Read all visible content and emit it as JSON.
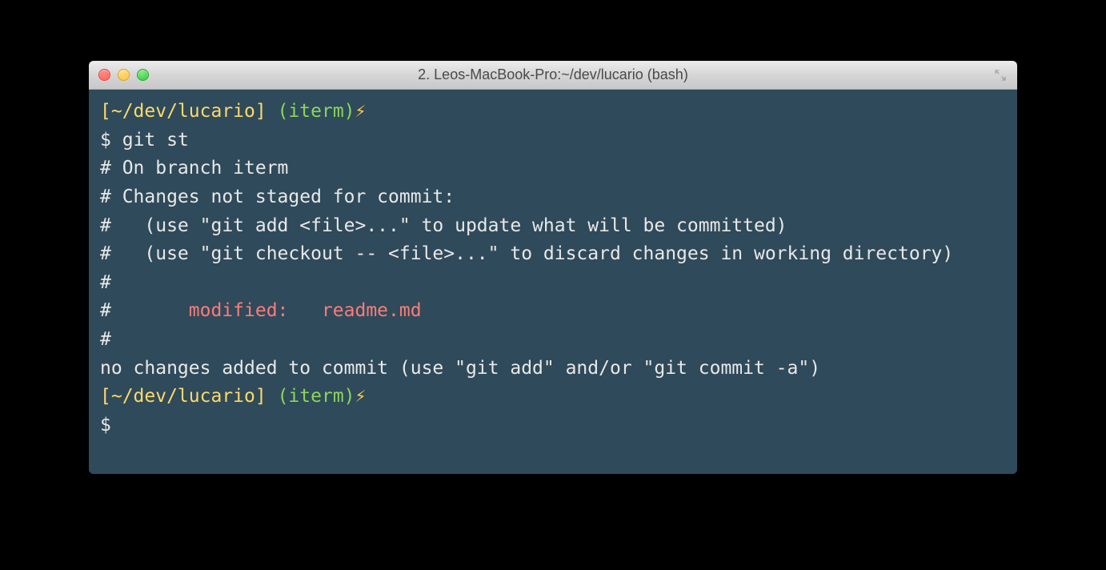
{
  "titlebar": {
    "title": "2. Leos-MacBook-Pro:~/dev/lucario (bash)"
  },
  "prompt": {
    "path": "[~/dev/lucario]",
    "branch": "(iterm)",
    "bolt": "⚡",
    "symbol": "$"
  },
  "commands": {
    "git_st": "git st"
  },
  "output": {
    "l1": "# On branch iterm",
    "l2": "# Changes not staged for commit:",
    "l3": "#   (use \"git add <file>...\" to update what will be committed)",
    "l4": "#   (use \"git checkout -- <file>...\" to discard changes in working directory)",
    "l5": "#",
    "l6_prefix": "#\t",
    "l6_modified": "modified:   readme.md",
    "l7": "#",
    "l8": "no changes added to commit (use \"git add\" and/or \"git commit -a\")"
  }
}
